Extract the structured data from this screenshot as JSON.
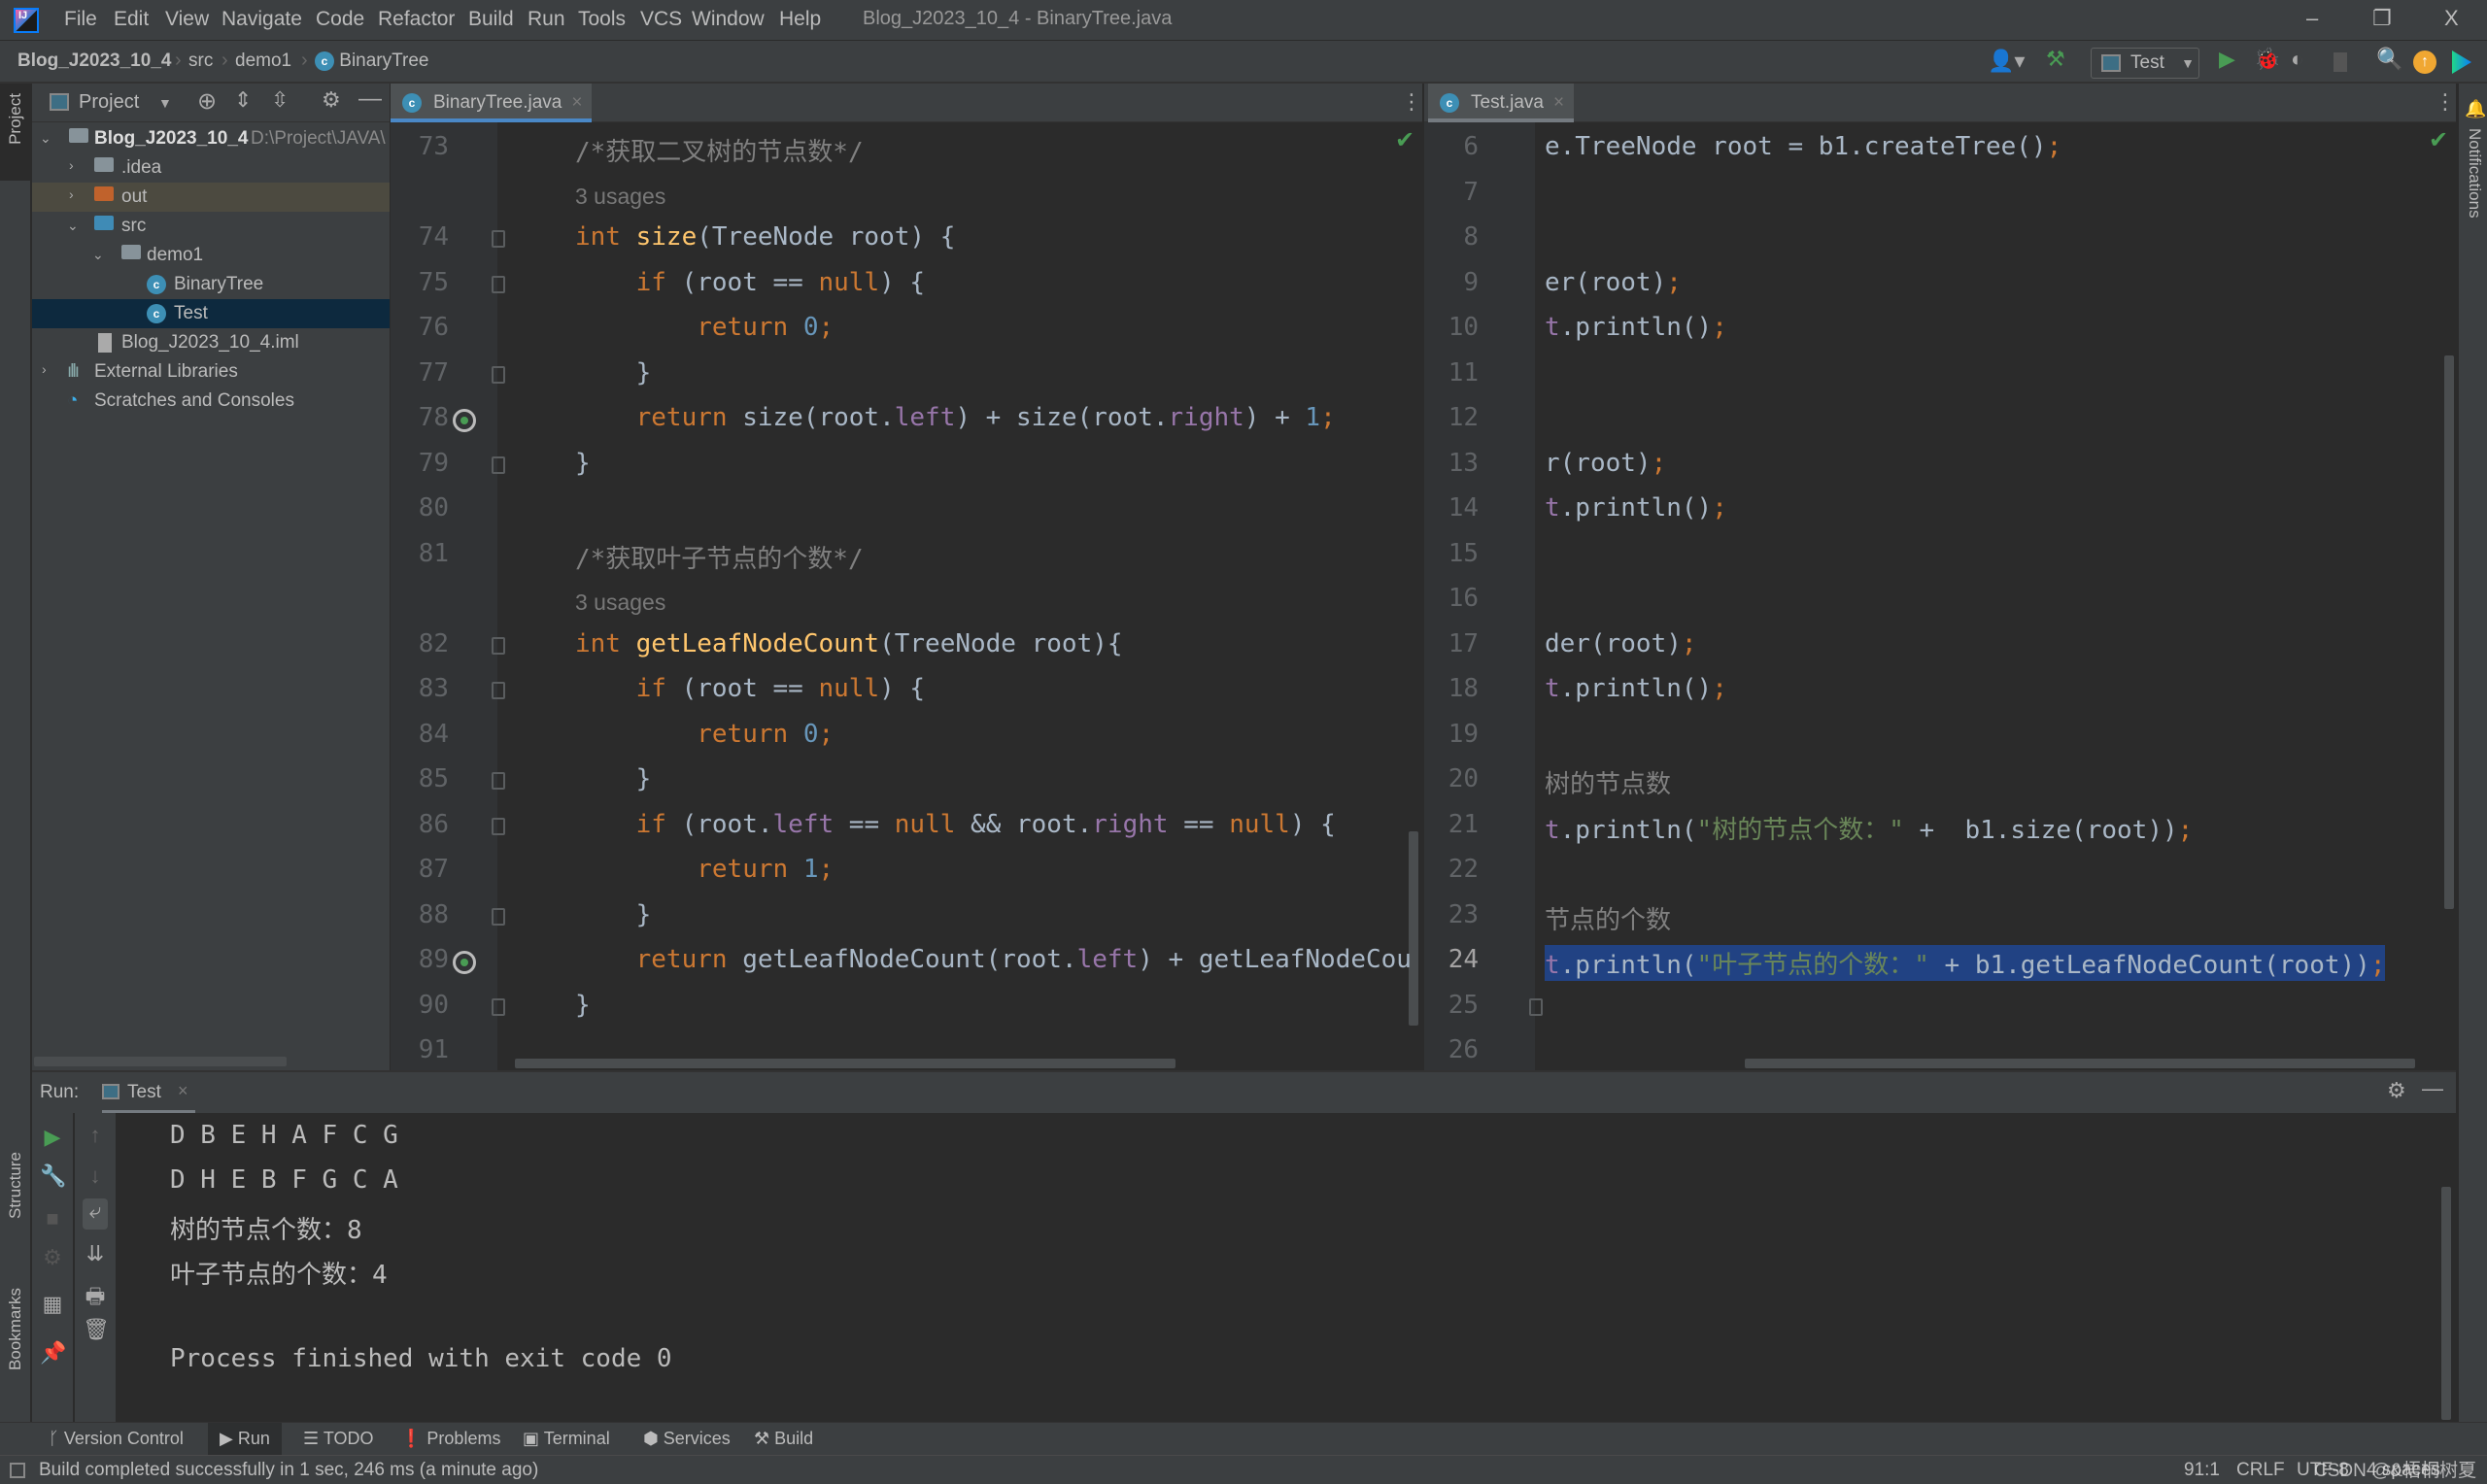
{
  "window": {
    "title": "Blog_J2023_10_4 - BinaryTree.java",
    "menu": [
      "File",
      "Edit",
      "View",
      "Navigate",
      "Code",
      "Refactor",
      "Build",
      "Run",
      "Tools",
      "VCS",
      "Window",
      "Help"
    ],
    "controls": {
      "minimize": "–",
      "restore": "❐",
      "close": "X"
    }
  },
  "breadcrumb": [
    "Blog_J2023_10_4",
    "src",
    "demo1",
    "BinaryTree"
  ],
  "toolbar": {
    "run_config": "Test",
    "icons": [
      "vcs-user-icon",
      "build-hammer-icon",
      "run-icon",
      "debug-icon",
      "coverage-icon",
      "stop-icon",
      "search-icon",
      "update-icon",
      "toolbox-icon"
    ]
  },
  "left_strip": {
    "project_label": "Project",
    "structure_label": "Structure",
    "bookmarks_label": "Bookmarks"
  },
  "right_strip": {
    "notifications_label": "Notifications"
  },
  "project": {
    "title": "Project",
    "root": {
      "name": "Blog_J2023_10_4",
      "path": "D:\\Project\\JAVA\\"
    },
    "items": [
      {
        "label": ".idea",
        "type": "folder"
      },
      {
        "label": "out",
        "type": "folder-excluded"
      },
      {
        "label": "src",
        "type": "folder-source"
      },
      {
        "label": "demo1",
        "type": "package"
      },
      {
        "label": "BinaryTree",
        "type": "class"
      },
      {
        "label": "Test",
        "type": "class-main",
        "selected": true
      },
      {
        "label": "Blog_J2023_10_4.iml",
        "type": "file"
      },
      {
        "label": "External Libraries",
        "type": "library"
      },
      {
        "label": "Scratches and Consoles",
        "type": "scratches"
      }
    ]
  },
  "editor_left": {
    "tab": "BinaryTree.java",
    "lines": [
      {
        "n": "73",
        "text": "/*获取二叉树的节点数*/"
      },
      {
        "n": "",
        "text": "3 usages"
      },
      {
        "n": "74",
        "text": "int size(TreeNode root) {"
      },
      {
        "n": "75",
        "text": "    if (root == null) {"
      },
      {
        "n": "76",
        "text": "        return 0;"
      },
      {
        "n": "77",
        "text": "    }"
      },
      {
        "n": "78",
        "text": "    return size(root.left) + size(root.right) + 1;"
      },
      {
        "n": "79",
        "text": "}"
      },
      {
        "n": "80",
        "text": ""
      },
      {
        "n": "81",
        "text": "/*获取叶子节点的个数*/"
      },
      {
        "n": "",
        "text": "3 usages"
      },
      {
        "n": "82",
        "text": "int getLeafNodeCount(TreeNode root){"
      },
      {
        "n": "83",
        "text": "    if (root == null) {"
      },
      {
        "n": "84",
        "text": "        return 0;"
      },
      {
        "n": "85",
        "text": "    }"
      },
      {
        "n": "86",
        "text": "    if (root.left == null && root.right == null) {"
      },
      {
        "n": "87",
        "text": "        return 1;"
      },
      {
        "n": "88",
        "text": "    }"
      },
      {
        "n": "89",
        "text": "    return getLeafNodeCount(root.left) + getLeafNodeCou"
      },
      {
        "n": "90",
        "text": "}"
      },
      {
        "n": "91",
        "text": ""
      }
    ]
  },
  "editor_right": {
    "tab": "Test.java",
    "lines": [
      {
        "n": "6",
        "text": "e.TreeNode root = b1.createTree();"
      },
      {
        "n": "7",
        "text": ""
      },
      {
        "n": "8",
        "text": ""
      },
      {
        "n": "9",
        "text": "er(root);"
      },
      {
        "n": "10",
        "text": "t.println();"
      },
      {
        "n": "11",
        "text": ""
      },
      {
        "n": "12",
        "text": ""
      },
      {
        "n": "13",
        "text": "r(root);"
      },
      {
        "n": "14",
        "text": "t.println();"
      },
      {
        "n": "15",
        "text": ""
      },
      {
        "n": "16",
        "text": ""
      },
      {
        "n": "17",
        "text": "der(root);"
      },
      {
        "n": "18",
        "text": "t.println();"
      },
      {
        "n": "19",
        "text": ""
      },
      {
        "n": "20",
        "text": "树的节点数"
      },
      {
        "n": "21",
        "text": "t.println(\"树的节点个数：\" +  b1.size(root));"
      },
      {
        "n": "22",
        "text": ""
      },
      {
        "n": "23",
        "text": "节点的个数"
      },
      {
        "n": "24",
        "text": "t.println(\"叶子节点的个数：\" + b1.getLeafNodeCount(root));"
      },
      {
        "n": "25",
        "text": ""
      },
      {
        "n": "26",
        "text": ""
      }
    ]
  },
  "run": {
    "label": "Run:",
    "tab": "Test",
    "output": [
      "D B E H A F C G",
      "D H E B F G C A",
      "树的节点个数：8",
      "叶子节点的个数：4",
      "",
      "Process finished with exit code 0"
    ]
  },
  "bottom_tabs": [
    "Version Control",
    "Run",
    "TODO",
    "Problems",
    "Terminal",
    "Services",
    "Build"
  ],
  "status": {
    "message": "Build completed successfully in 1 sec, 246 ms (a minute ago)",
    "position": "91:1",
    "line_sep": "CRLF",
    "encoding": "UTF-8",
    "indent": "4 spaces",
    "watermark": "CSDN @&梧桐树夏"
  }
}
